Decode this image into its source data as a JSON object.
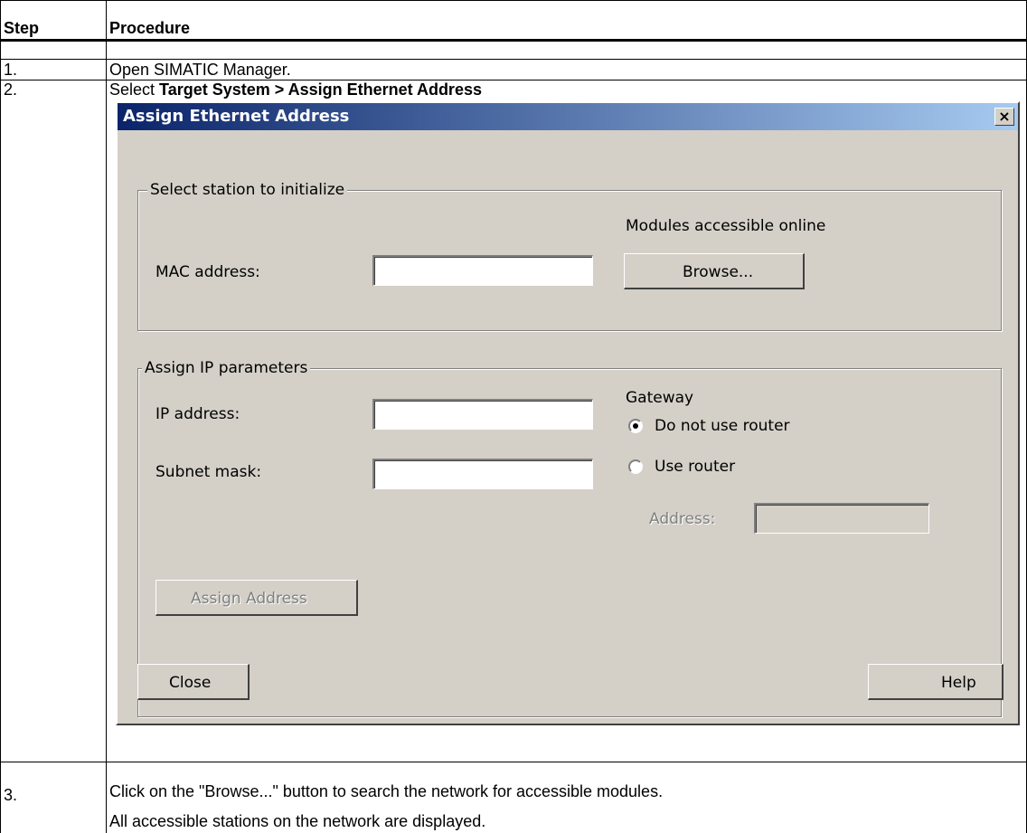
{
  "table": {
    "header": {
      "step": "Step",
      "procedure": "Procedure"
    },
    "rows": [
      {
        "step": "1.",
        "text": "Open SIMATIC Manager."
      },
      {
        "step": "2.",
        "text_prefix": "Select ",
        "text_bold": "Target System > Assign Ethernet Address"
      },
      {
        "step": "3.",
        "line1": "Click on the \"Browse...\" button to search the network for accessible modules.",
        "line2": "All accessible stations on the network are displayed."
      }
    ]
  },
  "dialog": {
    "title": "Assign Ethernet Address",
    "close_glyph": "×",
    "station_group": {
      "legend": "Select station to initialize",
      "modules_label": "Modules accessible online",
      "mac_label": "MAC address:",
      "mac_value": "",
      "browse_label": "Browse..."
    },
    "ip_group": {
      "legend": "Assign IP parameters",
      "ip_label": "IP address:",
      "ip_value": "",
      "subnet_label": "Subnet mask:",
      "subnet_value": "",
      "gateway_label": "Gateway",
      "radio_no_router": "Do not use router",
      "radio_use_router": "Use router",
      "selected": "no_router",
      "address_label": "Address:",
      "address_value": "",
      "assign_button": "Assign Address"
    },
    "close_button": "Close",
    "help_button": "Help"
  }
}
